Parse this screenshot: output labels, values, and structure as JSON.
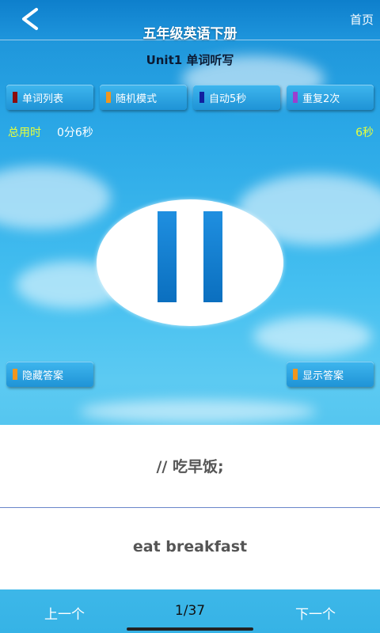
{
  "header": {
    "title": "五年级英语下册",
    "home_label": "首页"
  },
  "subtitle": "Unit1 单词听写",
  "toolbar": [
    {
      "label": "单词列表",
      "color": "#8b0d0d"
    },
    {
      "label": "随机模式",
      "color": "#f0961e"
    },
    {
      "label": "自动5秒",
      "color": "#1020a0"
    },
    {
      "label": "重复2次",
      "color": "#9b3fcf"
    }
  ],
  "timer": {
    "label": "总用时",
    "value": "0分6秒",
    "right": "6秒"
  },
  "answer_buttons": {
    "hide": "隐藏答案",
    "show": "显示答案",
    "color": "#f0961e"
  },
  "card": {
    "chinese": "// 吃早饭;",
    "english": "eat breakfast"
  },
  "footer": {
    "prev": "上一个",
    "page": "1/37",
    "next": "下一个"
  }
}
